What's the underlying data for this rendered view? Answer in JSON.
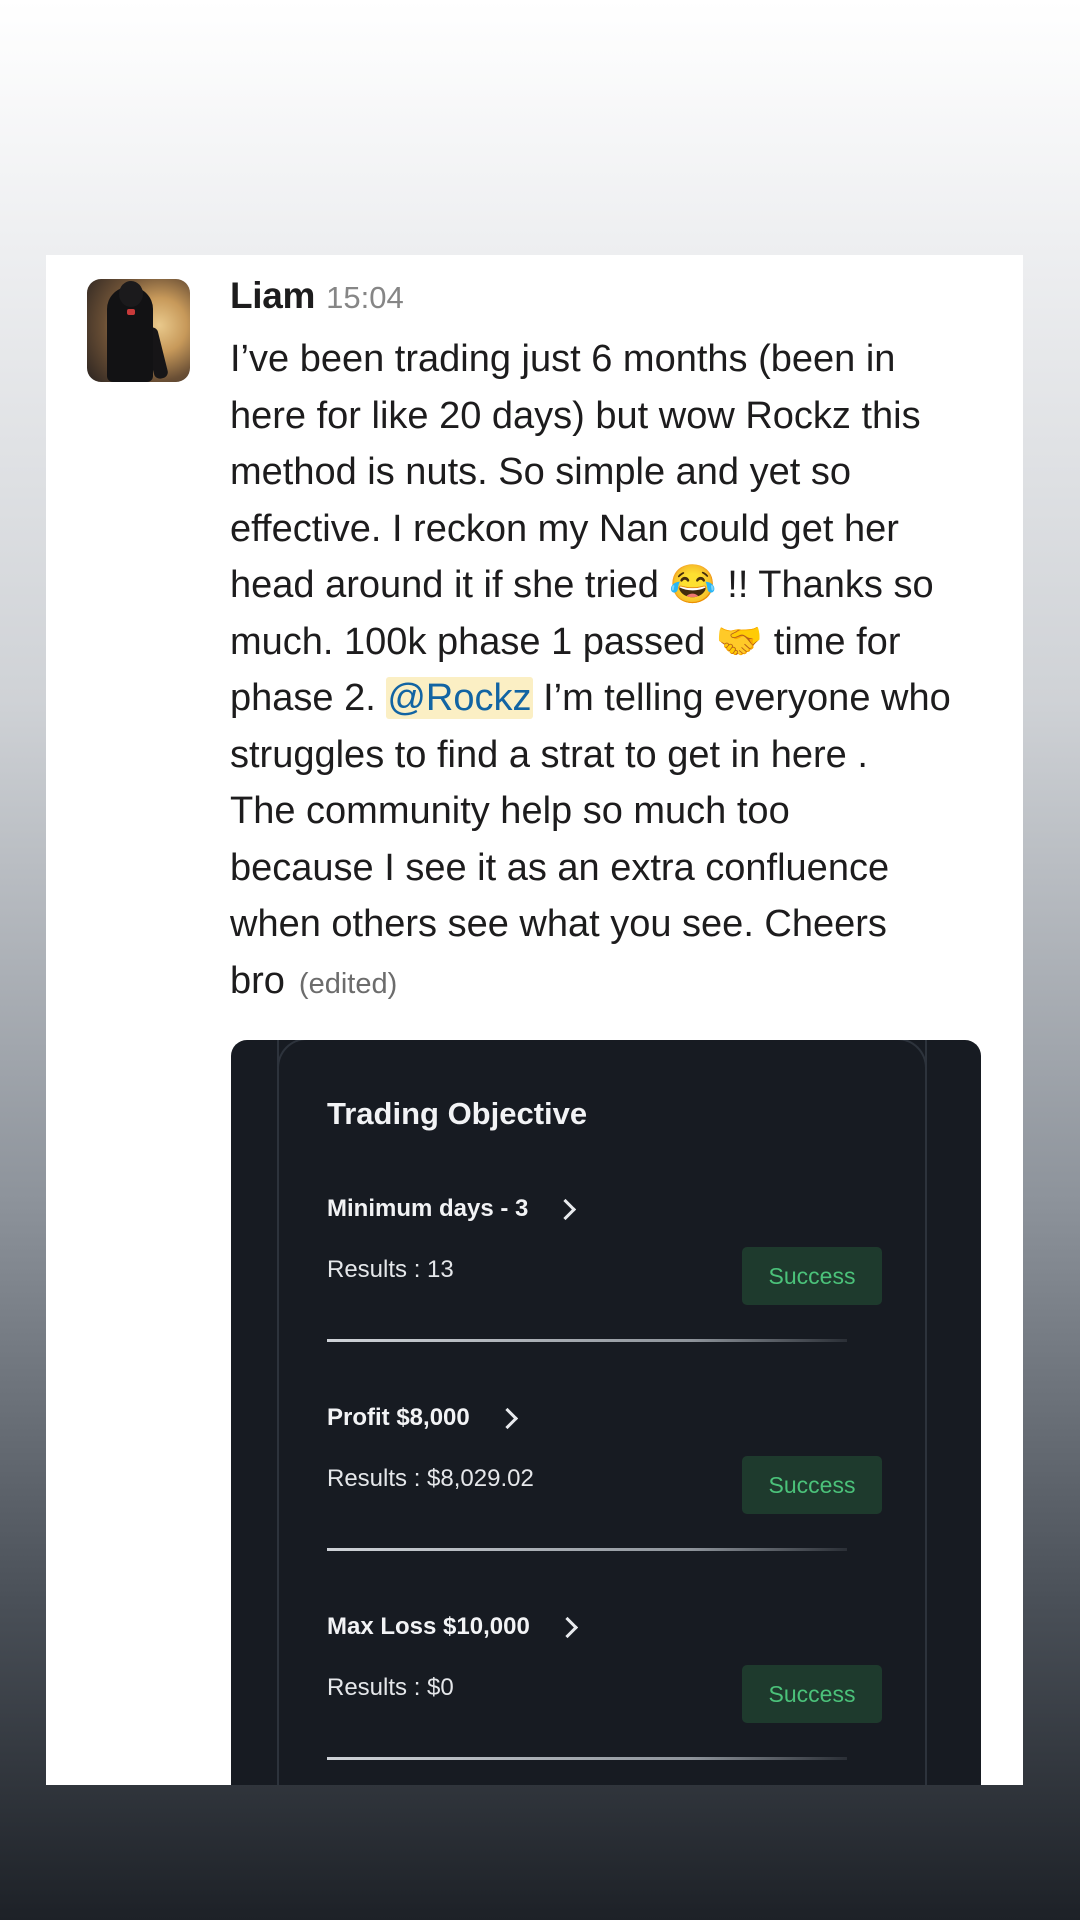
{
  "message": {
    "author": "Liam",
    "timestamp": "15:04",
    "lines": [
      "I’ve been trading just 6 months (been in",
      "here for like 20 days) but wow Rockz this",
      "method is nuts. So simple and yet so",
      "effective. I reckon my Nan could get her",
      "head around it if she tried",
      "much. 100k phase 1 passed",
      "phase 2.",
      "struggles to find a strat to get in here .",
      "The community help so much too",
      "because I see it as an extra confluence",
      "when others see what you see. Cheers",
      "bro"
    ],
    "emoji_laugh": "😂",
    "after_laugh": " !! Thanks so",
    "emoji_handshake": "🤝",
    "after_handshake": "  time for",
    "mention": "@Rockz",
    "after_mention": " I’m telling everyone who",
    "edited_label": "(edited)"
  },
  "attachment": {
    "title": "Trading Objective",
    "objectives": [
      {
        "name": "Minimum days - 3",
        "result": "Results : 13",
        "status": "Success"
      },
      {
        "name": "Profit $8,000",
        "result": "Results : $8,029.02",
        "status": "Success"
      },
      {
        "name": "Max Loss $10,000",
        "result": "Results : $0",
        "status": "Success"
      }
    ]
  },
  "colors": {
    "mention_text": "#1264a3",
    "mention_bg": "#fbefc4",
    "success_text": "#4bc27a",
    "success_bg": "#1e3a2d",
    "attachment_bg": "#171b22"
  }
}
